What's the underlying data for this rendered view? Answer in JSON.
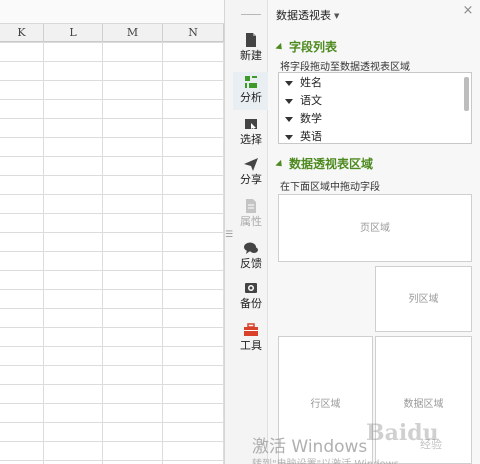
{
  "sheet": {
    "columns": [
      "K",
      "L",
      "M",
      "N"
    ]
  },
  "toolbar": {
    "items": [
      {
        "label": "新建",
        "icon": "new-file-icon"
      },
      {
        "label": "分析",
        "icon": "analysis-icon"
      },
      {
        "label": "选择",
        "icon": "select-icon"
      },
      {
        "label": "分享",
        "icon": "share-icon"
      },
      {
        "label": "属性",
        "icon": "properties-icon"
      },
      {
        "label": "反馈",
        "icon": "feedback-icon"
      },
      {
        "label": "备份",
        "icon": "backup-icon"
      },
      {
        "label": "工具",
        "icon": "toolbox-icon"
      }
    ],
    "grip": "☰"
  },
  "pivot": {
    "title": "数据透视表",
    "close": "×",
    "field_section": {
      "title": "字段列表",
      "hint": "将字段拖动至数据透视表区域",
      "fields": [
        "姓名",
        "语文",
        "数学",
        "英语"
      ]
    },
    "area_section": {
      "title": "数据透视表区域",
      "hint": "在下面区域中拖动字段",
      "zones": {
        "page": "页区域",
        "column": "列区域",
        "row": "行区域",
        "data": "数据区域"
      }
    }
  },
  "overlay": {
    "activation_title": "激活 Windows",
    "activation_sub": "转到\"电脑设置\"以激活 Windows。",
    "brand": "Baidu",
    "brand_sub": "经验"
  },
  "colors": {
    "section_green": "#4d8a1f",
    "toolbar_bg": "#f4f4f4",
    "pane_bg": "#f7f7f7",
    "toolbox_red": "#d9412b",
    "analysis_green": "#3d9a2a"
  }
}
